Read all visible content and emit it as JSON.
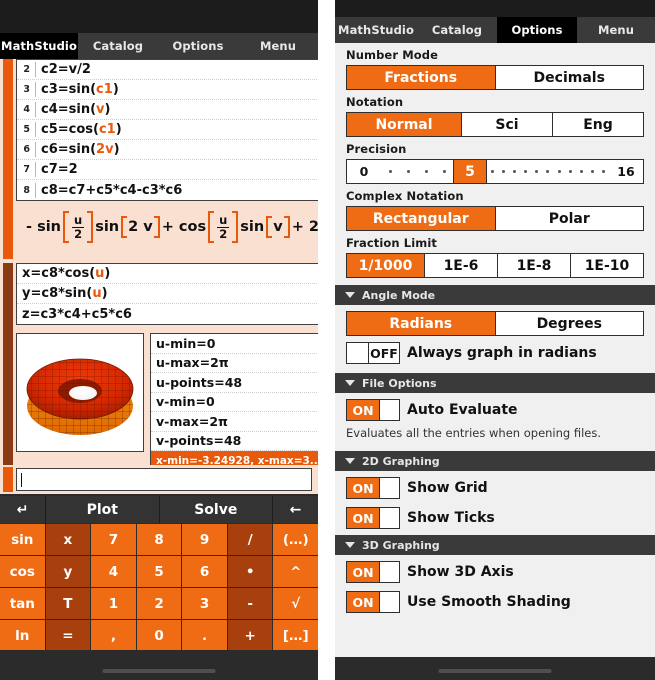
{
  "left_panel": {
    "tabs": [
      {
        "label": "MathStudio",
        "active": true
      },
      {
        "label": "Catalog",
        "active": false
      },
      {
        "label": "Options",
        "active": false
      },
      {
        "label": "Menu",
        "active": false
      }
    ],
    "entries": [
      {
        "num": "2",
        "text": "c2=v/2"
      },
      {
        "num": "3",
        "text": "c3=sin(c1)"
      },
      {
        "num": "4",
        "text": "c4=sin(v)"
      },
      {
        "num": "5",
        "text": "c5=cos(c1)"
      },
      {
        "num": "6",
        "text": "c6=sin(2v)"
      },
      {
        "num": "7",
        "text": "c7=2"
      },
      {
        "num": "8",
        "text": "c8=c7+c5*c4-c3*c6"
      }
    ],
    "result_expression": {
      "lead": "- sin",
      "frac1_num": "u",
      "frac1_den": "2",
      "mid1": "sin",
      "arg1": "2 v",
      "plus1": "+ cos",
      "frac2_num": "u",
      "frac2_den": "2",
      "mid2": "sin",
      "arg2": "v",
      "tail": "+ 2"
    },
    "param_equations": [
      "x=c8*cos(u)",
      "y=c8*sin(u)",
      "z=c3*c4+c5*c6"
    ],
    "plot_params": [
      "u-min=0",
      "u-max=2π",
      "u-points=48",
      "v-min=0",
      "v-max=2π",
      "v-points=48"
    ],
    "plot_status": "x-min=-3.24928, x-max=3....",
    "input_value": "",
    "input_placeholder": "",
    "action_buttons": [
      {
        "name": "enter",
        "label": "↵"
      },
      {
        "name": "plot",
        "label": "Plot"
      },
      {
        "name": "solve",
        "label": "Solve"
      },
      {
        "name": "backspace",
        "label": "←"
      }
    ],
    "keypad": [
      [
        {
          "l": "sin",
          "t": "o"
        },
        {
          "l": "x",
          "t": "d"
        },
        {
          "l": "7",
          "t": "o"
        },
        {
          "l": "8",
          "t": "o"
        },
        {
          "l": "9",
          "t": "o"
        },
        {
          "l": "/",
          "t": "d"
        },
        {
          "l": "(…)",
          "t": "o"
        }
      ],
      [
        {
          "l": "cos",
          "t": "o"
        },
        {
          "l": "y",
          "t": "d"
        },
        {
          "l": "4",
          "t": "o"
        },
        {
          "l": "5",
          "t": "o"
        },
        {
          "l": "6",
          "t": "o"
        },
        {
          "l": "•",
          "t": "d"
        },
        {
          "l": "^",
          "t": "o"
        }
      ],
      [
        {
          "l": "tan",
          "t": "o"
        },
        {
          "l": "T",
          "t": "d"
        },
        {
          "l": "1",
          "t": "o"
        },
        {
          "l": "2",
          "t": "o"
        },
        {
          "l": "3",
          "t": "o"
        },
        {
          "l": "-",
          "t": "d"
        },
        {
          "l": "√",
          "t": "o"
        }
      ],
      [
        {
          "l": "ln",
          "t": "o"
        },
        {
          "l": "=",
          "t": "d"
        },
        {
          "l": ",",
          "t": "o"
        },
        {
          "l": "0",
          "t": "o"
        },
        {
          "l": ".",
          "t": "o"
        },
        {
          "l": "+",
          "t": "d"
        },
        {
          "l": "[…]",
          "t": "o"
        }
      ]
    ]
  },
  "right_panel": {
    "tabs": [
      {
        "label": "MathStudio",
        "active": false
      },
      {
        "label": "Catalog",
        "active": false
      },
      {
        "label": "Options",
        "active": true
      },
      {
        "label": "Menu",
        "active": false
      }
    ],
    "number_mode": {
      "label": "Number Mode",
      "options": [
        {
          "label": "Fractions",
          "selected": true
        },
        {
          "label": "Decimals",
          "selected": false
        }
      ]
    },
    "notation": {
      "label": "Notation",
      "options": [
        {
          "label": "Normal",
          "selected": true
        },
        {
          "label": "Sci",
          "selected": false
        },
        {
          "label": "Eng",
          "selected": false
        }
      ]
    },
    "precision": {
      "label": "Precision",
      "min": "0",
      "max": "16",
      "value": "5",
      "dots_before": 4,
      "dots_after": 11
    },
    "complex_notation": {
      "label": "Complex Notation",
      "options": [
        {
          "label": "Rectangular",
          "selected": true
        },
        {
          "label": "Polar",
          "selected": false
        }
      ]
    },
    "fraction_limit": {
      "label": "Fraction Limit",
      "options": [
        {
          "label": "1/1000",
          "selected": true
        },
        {
          "label": "1E-6",
          "selected": false
        },
        {
          "label": "1E-8",
          "selected": false
        },
        {
          "label": "1E-10",
          "selected": false
        }
      ]
    },
    "sections": [
      {
        "title": "Angle Mode",
        "segmented": {
          "options": [
            {
              "label": "Radians",
              "selected": true
            },
            {
              "label": "Degrees",
              "selected": false
            }
          ]
        },
        "toggles": [
          {
            "label": "Always graph in radians",
            "state": "OFF",
            "on": false
          }
        ],
        "help": ""
      },
      {
        "title": "File Options",
        "toggles": [
          {
            "label": "Auto Evaluate",
            "state": "ON",
            "on": true
          }
        ],
        "help": "Evaluates all the entries when opening files."
      },
      {
        "title": "2D Graphing",
        "toggles": [
          {
            "label": "Show Grid",
            "state": "ON",
            "on": true
          },
          {
            "label": "Show Ticks",
            "state": "ON",
            "on": true
          }
        ],
        "help": ""
      },
      {
        "title": "3D Graphing",
        "toggles": [
          {
            "label": "Show 3D Axis",
            "state": "ON",
            "on": true
          },
          {
            "label": "Use Smooth Shading",
            "state": "ON",
            "on": true
          }
        ],
        "help": ""
      }
    ]
  },
  "colors": {
    "accent": "#ef6c14",
    "accent_dark": "#a8400e",
    "chrome": "#2b2b2b",
    "worksheet_bg": "#f9e0d0",
    "options_bg": "#f0f0f0"
  }
}
